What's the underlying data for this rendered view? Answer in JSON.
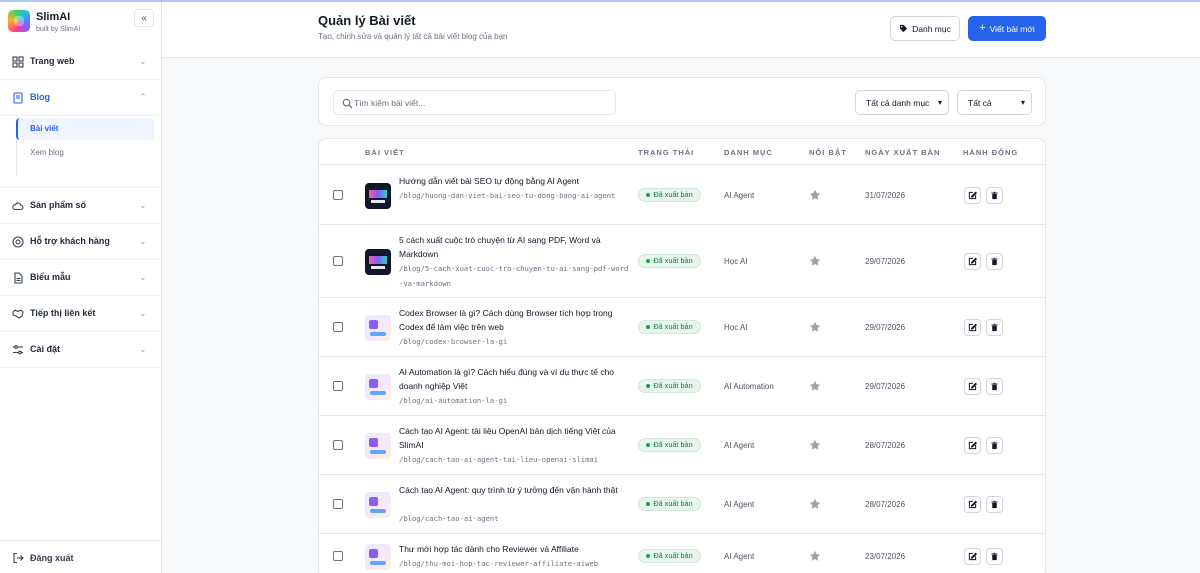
{
  "brand": {
    "name": "SlimAI",
    "subtitle": "built by SlimAI"
  },
  "sidebar": {
    "items": [
      {
        "label": "Trang web",
        "icon": "grid-icon"
      },
      {
        "label": "Blog",
        "icon": "book-icon",
        "active": true,
        "children": [
          {
            "label": "Bài viết",
            "active": true
          },
          {
            "label": "Xem blog"
          }
        ]
      },
      {
        "label": "Sản phẩm số",
        "icon": "cloud-icon"
      },
      {
        "label": "Hỗ trợ khách hàng",
        "icon": "support-icon"
      },
      {
        "label": "Biểu mẫu",
        "icon": "file-icon"
      },
      {
        "label": "Tiếp thị liên kết",
        "icon": "handshake-icon"
      },
      {
        "label": "Cài đặt",
        "icon": "settings-icon"
      }
    ],
    "logout_label": "Đăng xuất"
  },
  "header": {
    "title": "Quản lý Bài viết",
    "subtitle": "Tạo, chỉnh sửa và quản lý tất cả bài viết blog của bạn",
    "category_button": "Danh mục",
    "new_post_button": "Viết bài mới"
  },
  "filters": {
    "search_placeholder": "Tìm kiếm bài viết...",
    "category_select": "Tất cả danh mục",
    "status_select": "Tất cả"
  },
  "table": {
    "columns": [
      "BÀI VIẾT",
      "TRẠNG THÁI",
      "DANH MỤC",
      "NỔI BẬT",
      "NGÀY XUẤT BẢN",
      "HÀNH ĐỘNG"
    ],
    "rows": [
      {
        "title": "Hướng dẫn viết bài SEO tự động bằng AI Agent",
        "slug": "/blog/huong-dan-viet-bai-seo-tu-dong-bang-ai-agent",
        "status": "Đã xuất bản",
        "category": "AI Agent",
        "date": "31/07/2026"
      },
      {
        "title": "5 cách xuất cuộc trò chuyện từ AI sang PDF, Word và Markdown",
        "slug": "/blog/5-cach-xuat-cuoc-tro-chuyen-tu-ai-sang-pdf-word-va-markdown",
        "status": "Đã xuất bản",
        "category": "Học AI",
        "date": "29/07/2026"
      },
      {
        "title": "Codex Browser là gì? Cách dùng Browser tích hợp trong Codex để làm việc trên web",
        "slug": "/blog/codex-browser-la-gi",
        "status": "Đã xuất bản",
        "category": "Học AI",
        "date": "29/07/2026"
      },
      {
        "title": "AI Automation là gì? Cách hiểu đúng và ví dụ thực tế cho doanh nghiệp Việt",
        "slug": "/blog/ai-automation-la-gi",
        "status": "Đã xuất bản",
        "category": "AI Automation",
        "date": "29/07/2026"
      },
      {
        "title": "Cách tạo AI Agent: tài liệu OpenAI bản dịch tiếng Việt của SlimAI",
        "slug": "/blog/cach-tao-ai-agent-tai-lieu-openai-slimai",
        "status": "Đã xuất bản",
        "category": "AI Agent",
        "date": "28/07/2026"
      },
      {
        "title": "Cách tạo AI Agent: quy trình từ ý tưởng đến vận hành thật",
        "slug": "/blog/cach-tao-ai-agent",
        "status": "Đã xuất bản",
        "category": "AI Agent",
        "date": "28/07/2026"
      },
      {
        "title": "Thư mời hợp tác dành cho Reviewer và Affiliate",
        "slug": "/blog/thu-moi-hop-tac-reviewer-affiliate-aiweb",
        "status": "Đã xuất bản",
        "category": "AI Agent",
        "date": "23/07/2026"
      }
    ]
  }
}
